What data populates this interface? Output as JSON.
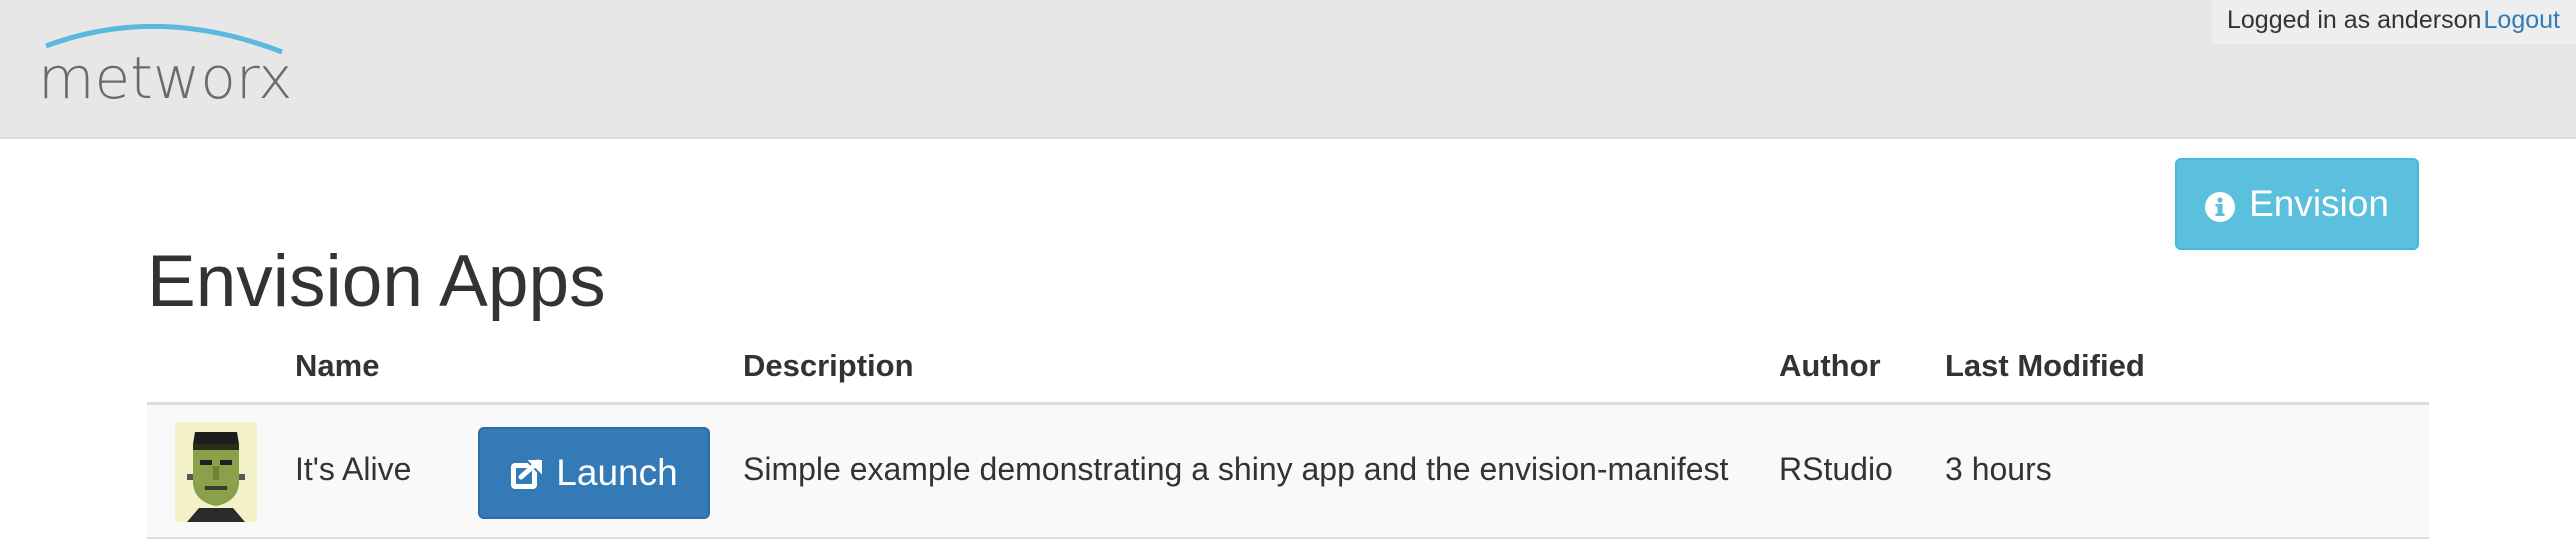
{
  "header": {
    "logo_text": "metworx",
    "user_label": "Logged in as anderson",
    "logout_label": "Logout"
  },
  "actions": {
    "envision_label": "Envision",
    "envision_icon": "info-circle-icon"
  },
  "page": {
    "title": "Envision Apps"
  },
  "table": {
    "headers": {
      "name": "Name",
      "description": "Description",
      "author": "Author",
      "modified": "Last Modified"
    },
    "rows": [
      {
        "thumbnail": "frankenstein-avatar",
        "name": "It's Alive",
        "launch_label": "Launch",
        "launch_icon": "external-link-icon",
        "description": "Simple example demonstrating a shiny app and the envision-manifest",
        "author": "RStudio",
        "modified": "3 hours"
      }
    ]
  },
  "colors": {
    "header_bg": "#e7e7e7",
    "info_button": "#5bc0de",
    "primary_button": "#337ab7",
    "logo_arc": "#5bb8de",
    "link": "#337ab7"
  }
}
